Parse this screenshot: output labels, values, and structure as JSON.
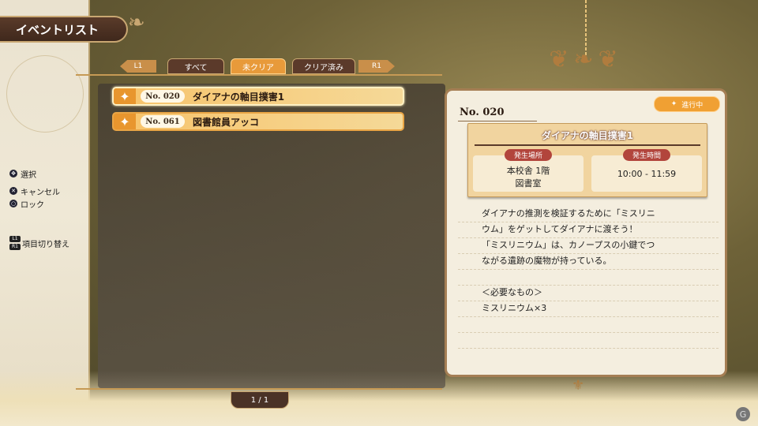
{
  "header": {
    "title": "イベントリスト"
  },
  "tabs": {
    "left_button": "L1",
    "right_button": "R1",
    "items": [
      "すべて",
      "未クリア",
      "クリア済み"
    ],
    "active_index": 1
  },
  "events": [
    {
      "no": "No. 020",
      "name": "ダイアナの軸目撲害1"
    },
    {
      "no": "No. 061",
      "name": "図書館員アッコ"
    }
  ],
  "pager": "1 / 1",
  "controls": [
    {
      "icon": "stick",
      "label": "選択"
    },
    {
      "icon": "cross-button",
      "label": "キャンセル"
    },
    {
      "icon": "circle-button",
      "label": "ロック"
    },
    {
      "icon": "l1-r1",
      "label": "項目切り替え"
    }
  ],
  "detail": {
    "no": "No. 020",
    "status": "進行中",
    "title": "ダイアナの軸目撲害1",
    "place_label": "発生場所",
    "place_line1": "本校舎 1階",
    "place_line2": "図書室",
    "time_label": "発生時間",
    "time_value": "10:00 - 11:59",
    "desc1": "ダイアナの推測を検証するために「ミスリニ",
    "desc2": "ウム」をゲットしてダイアナに渡そう！",
    "desc3": "「ミスリニウム」は、カノープスの小鍵でつ",
    "desc4": "ながる遺跡の魔物が持っている。",
    "req_header": "＜必要なもの＞",
    "req_item": "ミスリニウム×3"
  },
  "colors": {
    "accent_orange": "#f0a033",
    "panel_border": "#a57e54",
    "label_red": "#b2453c"
  }
}
